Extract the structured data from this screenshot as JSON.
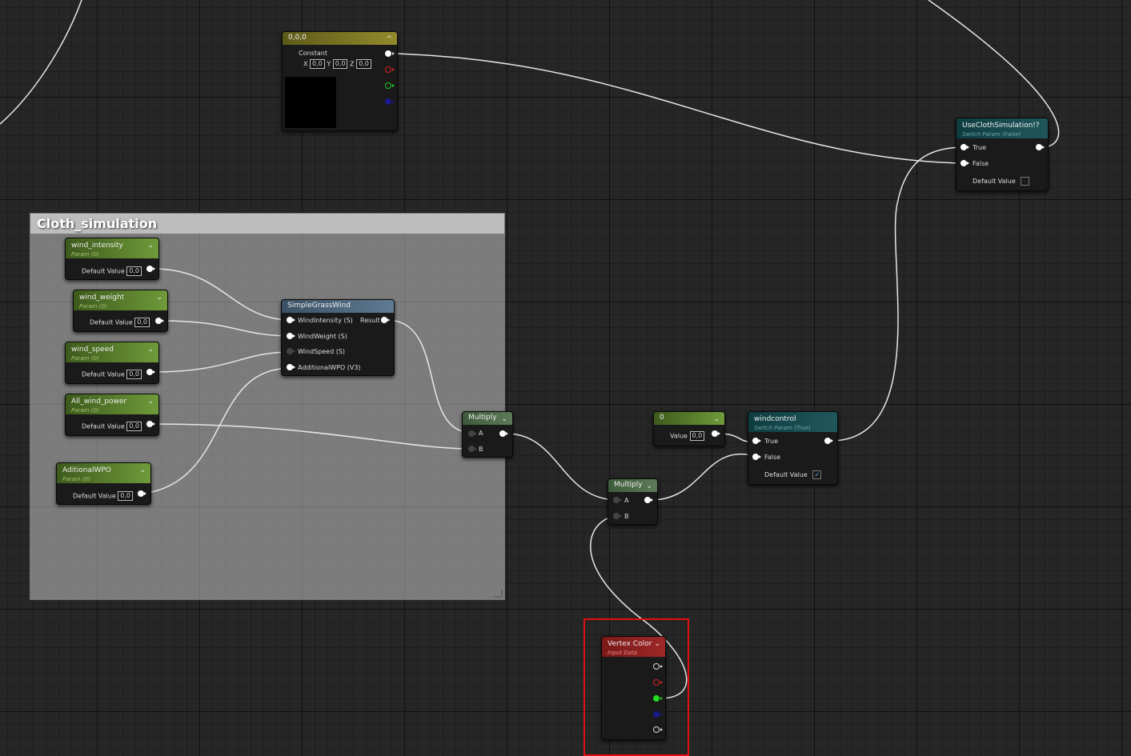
{
  "constant_node": {
    "title": "0,0,0",
    "label": "Constant",
    "x_label": "X",
    "x": "0,0",
    "y_label": "Y",
    "y": "0,0",
    "z_label": "Z",
    "z": "0,0"
  },
  "comment": {
    "title": "Cloth_simulation"
  },
  "params": [
    {
      "title": "wind_intensity",
      "subtitle": "Param (0)",
      "label": "Default Value",
      "value": "0,0"
    },
    {
      "title": "wind_weight",
      "subtitle": "Param (0)",
      "label": "Default Value",
      "value": "0,0"
    },
    {
      "title": "wind_speed",
      "subtitle": "Param (0)",
      "label": "Default Value",
      "value": "0,0"
    },
    {
      "title": "All_wind_power",
      "subtitle": "Param (0)",
      "label": "Default Value",
      "value": "0,0"
    },
    {
      "title": "AditionalWPO",
      "subtitle": "Param (0)",
      "label": "Default Value",
      "value": "0,0"
    }
  ],
  "simple_grass_wind": {
    "title": "SimpleGrassWind",
    "inputs": [
      "WindIntensity (S)",
      "WindWeight (S)",
      "WindSpeed (S)",
      "AdditionalWPO (V3)"
    ],
    "output": "Result"
  },
  "multiply1": {
    "title": "Multiply",
    "a": "A",
    "b": "B"
  },
  "multiply2": {
    "title": "Multiply",
    "a": "A",
    "b": "B"
  },
  "scalar_zero": {
    "title": "0",
    "label": "Value",
    "value": "0,0"
  },
  "windcontrol": {
    "title": "windcontrol",
    "subtitle": "Switch Param (True)",
    "true_label": "True",
    "false_label": "False",
    "default_label": "Default Value",
    "checkmark": "✓"
  },
  "use_cloth": {
    "title": "UseClothSimulation!?",
    "subtitle": "Switch Param (False)",
    "true_label": "True",
    "false_label": "False",
    "default_label": "Default Value"
  },
  "vertex_color": {
    "title": "Vertex Color",
    "subtitle": "Input Data"
  },
  "chevron": "⌄",
  "collapse": "^",
  "colors": {
    "selection": "#e01010",
    "wire": "#e6e6e6",
    "param_header": "#5a7d30",
    "switch_header": "#1a4a4e",
    "vertex_header": "#8a1e1e"
  }
}
